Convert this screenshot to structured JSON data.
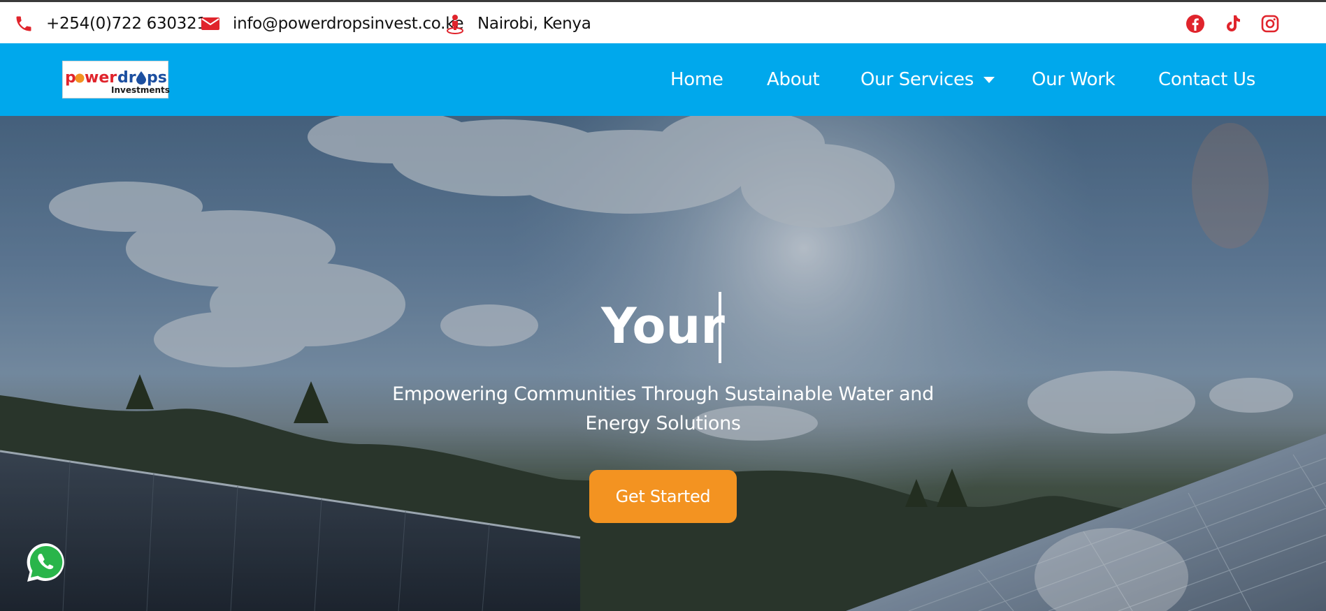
{
  "topbar": {
    "phone": "+254(0)722 630321",
    "email": "info@powerdropsinvest.co.ke",
    "location": "Nairobi, Kenya",
    "icons": {
      "phone": "phone-icon",
      "email": "envelope-icon",
      "location": "map-marker-person-icon"
    },
    "social": [
      "facebook-icon",
      "tiktok-icon",
      "instagram-icon"
    ],
    "icon_color": "#e0242c"
  },
  "nav": {
    "logo": {
      "word_main": "powerdr",
      "word_tail": "ps",
      "tagline": "Investments"
    },
    "items": [
      {
        "label": "Home"
      },
      {
        "label": "About"
      },
      {
        "label": "Our Services"
      },
      {
        "label": "Our Work"
      },
      {
        "label": "Contact Us"
      }
    ],
    "background": "#00a8ec"
  },
  "hero": {
    "title": "Your",
    "subtitle": "Empowering Communities Through Sustainable Water and Energy Solutions",
    "cta_label": "Get Started",
    "cta_color": "#f39321"
  },
  "floating": {
    "whatsapp": "whatsapp-icon"
  }
}
